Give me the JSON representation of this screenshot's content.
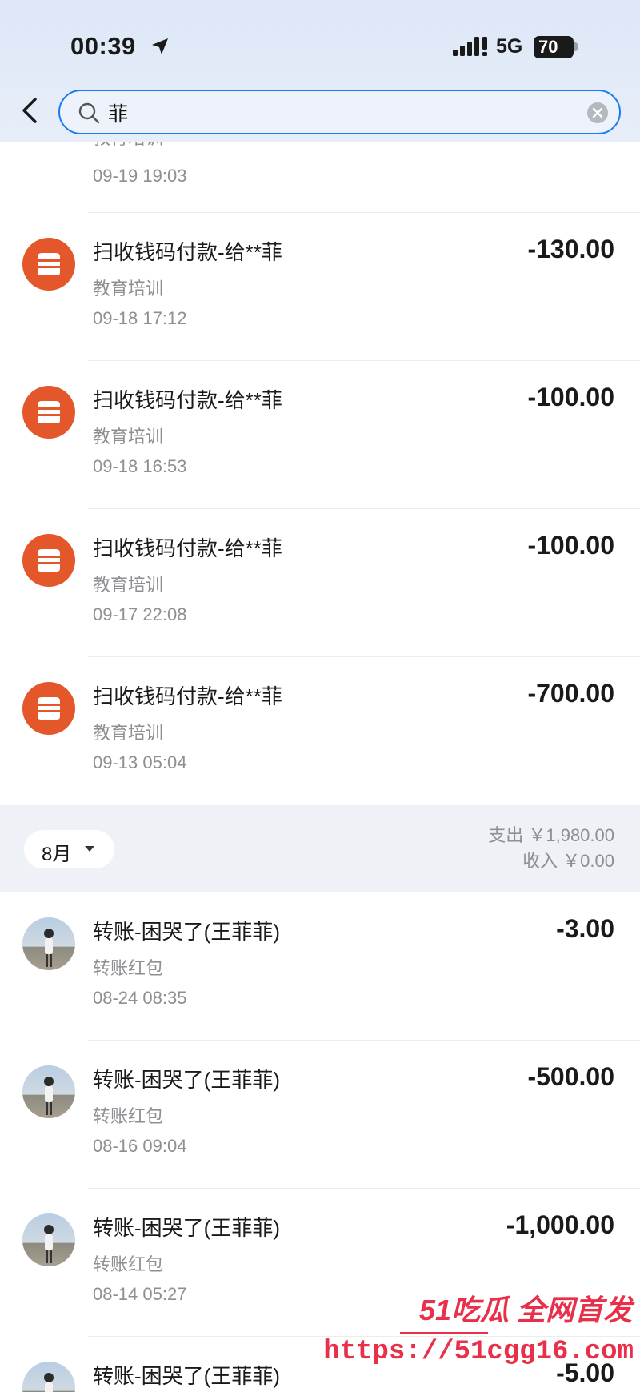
{
  "status": {
    "time": "00:39",
    "network": "5G",
    "battery": "70"
  },
  "search": {
    "query": "菲"
  },
  "clipped_item": {
    "category": "教育培训",
    "time": "09-19 19:03"
  },
  "september": [
    {
      "title": "扫收钱码付款-给**菲",
      "category": "教育培训",
      "time": "09-18 17:12",
      "amount": "-130.00"
    },
    {
      "title": "扫收钱码付款-给**菲",
      "category": "教育培训",
      "time": "09-18 16:53",
      "amount": "-100.00"
    },
    {
      "title": "扫收钱码付款-给**菲",
      "category": "教育培训",
      "time": "09-17 22:08",
      "amount": "-100.00"
    },
    {
      "title": "扫收钱码付款-给**菲",
      "category": "教育培训",
      "time": "09-13 05:04",
      "amount": "-700.00"
    }
  ],
  "month_summary": {
    "month": "8月",
    "expense": "支出 ￥1,980.00",
    "income": "收入 ￥0.00"
  },
  "august": [
    {
      "title": "转账-困哭了(王菲菲)",
      "category": "转账红包",
      "time": "08-24 08:35",
      "amount": "-3.00"
    },
    {
      "title": "转账-困哭了(王菲菲)",
      "category": "转账红包",
      "time": "08-16 09:04",
      "amount": "-500.00"
    },
    {
      "title": "转账-困哭了(王菲菲)",
      "category": "转账红包",
      "time": "08-14 05:27",
      "amount": "-1,000.00"
    },
    {
      "title": "转账-困哭了(王菲菲)",
      "category": "",
      "time": "",
      "amount": "-5.00"
    }
  ],
  "watermark": {
    "top": "51吃瓜 全网首发",
    "url": "https://51cgg16.com"
  },
  "colors": {
    "accent": "#1a7cf2",
    "shop_icon": "#e4572a",
    "watermark": "#e8304a"
  }
}
